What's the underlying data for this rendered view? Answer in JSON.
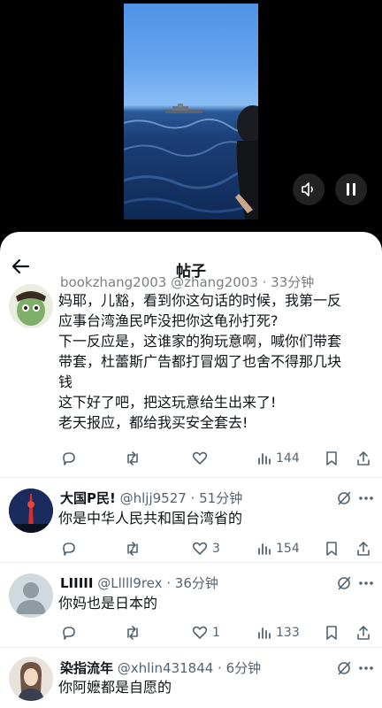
{
  "header": {
    "title": "帖子"
  },
  "video": {
    "controls": [
      "volume-icon",
      "pause-icon"
    ]
  },
  "posts": [
    {
      "name_line": "bookzhang2003 @zhang2003 · 33分钟",
      "lines": [
        "妈耶，儿豁，看到你这句话的时候，我第一反",
        "应事台湾渔民咋没把你这龟孙打死?",
        "下一反应是，这谁家的狗玩意啊，喊你们带套",
        "带套，杜蕾斯广告都打冒烟了也舍不得那几块",
        "钱",
        "这下好了吧，把这玩意给生出来了!",
        "老天报应，都给我买安全套去!"
      ],
      "views": "144"
    },
    {
      "name": "大国P民!",
      "handle": "@hljj9527 · 51分钟",
      "text": "你是中华人民共和国台湾省的",
      "likes": "3",
      "views": "154"
    },
    {
      "name": "LIIIII",
      "handle": "@Lllll9rex · 36分钟",
      "text": "你妈也是日本的",
      "likes": "1",
      "views": "133"
    },
    {
      "name": "染指流年",
      "handle": "@xhlin431844 · 6分钟",
      "text": "你阿嬷都是自愿的"
    }
  ],
  "colors": {
    "text": "#0f1419",
    "secondary": "#536471",
    "divider": "#eff3f4"
  }
}
